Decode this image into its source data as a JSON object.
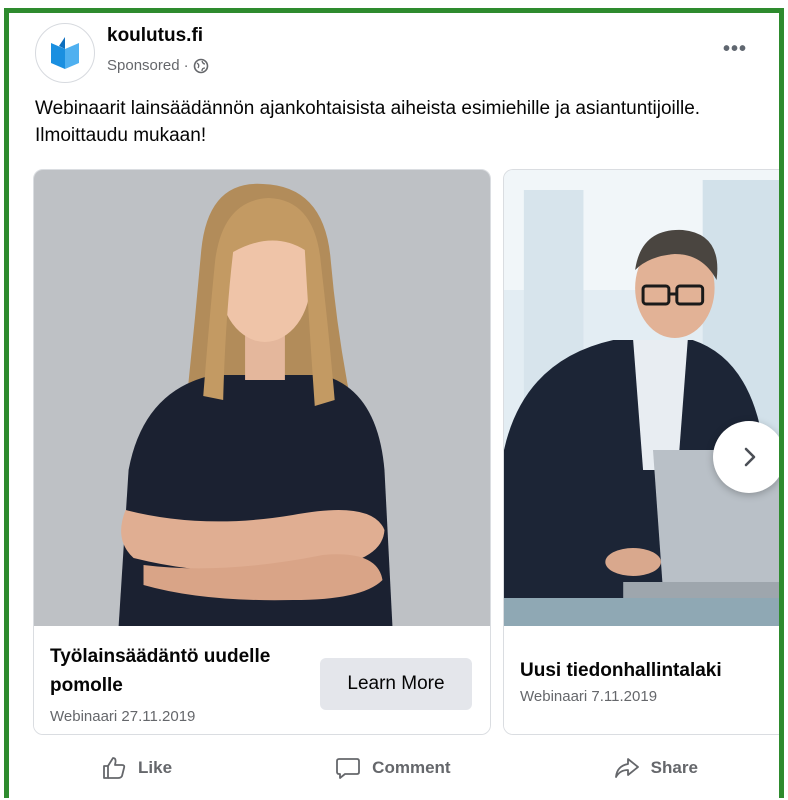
{
  "post": {
    "page_name": "koulutus.fi",
    "sponsored_label": "Sponsored",
    "separator": "·",
    "more_label": "•••",
    "text": "Webinaarit lainsäädännön ajankohtaisista aiheista esimiehille ja asiantuntijoille. Ilmoittaudu mukaan!"
  },
  "carousel": {
    "cards": [
      {
        "title": "Työlainsäädäntö uudelle pomolle",
        "subtitle": "Webinaari 27.11.2019",
        "cta_label": "Learn More"
      },
      {
        "title": "Uusi tiedonhallintalaki",
        "subtitle": "Webinaari 7.11.2019"
      }
    ]
  },
  "actions": {
    "like": "Like",
    "comment": "Comment",
    "share": "Share"
  },
  "icons": {
    "avatar": "book-logo-icon",
    "audience": "globe-icon",
    "more": "more-options-icon",
    "next": "chevron-right-icon",
    "like": "thumbs-up-icon",
    "comment": "comment-bubble-icon",
    "share": "share-arrow-icon"
  },
  "colors": {
    "frame_border": "#2e8b2e",
    "secondary_text": "#65676b",
    "button_bg": "#e4e6eb",
    "logo_blue": "#1a8fe0"
  }
}
